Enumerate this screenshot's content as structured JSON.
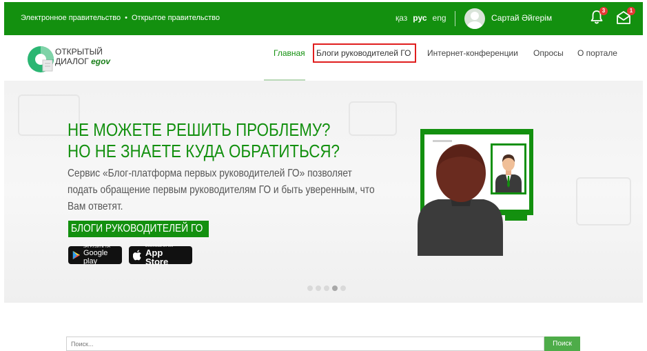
{
  "topbar": {
    "links": [
      "Электронное правительство",
      "Открытое правительство"
    ],
    "separator": "•",
    "languages": [
      {
        "code": "қаз",
        "active": false
      },
      {
        "code": "рус",
        "active": true
      },
      {
        "code": "eng",
        "active": false
      }
    ],
    "username": "Сартай Әйгерім",
    "notifications_count": "3",
    "messages_count": "1",
    "bg_color": "#13900f"
  },
  "header": {
    "logo_line1": "ОТКРЫТЫЙ",
    "logo_line2": "ДИАЛОГ",
    "logo_brand": "egov",
    "nav": {
      "main": "Главная",
      "blogs": "Блоги руководителей ГО",
      "conferences": "Интернет-конференции",
      "polls": "Опросы",
      "about": "О портале"
    }
  },
  "hero": {
    "headline1": "НЕ МОЖЕТЕ РЕШИТЬ ПРОБЛЕМУ?",
    "headline2": "НО НЕ ЗНАЕТЕ КУДА ОБРАТИТЬСЯ?",
    "description": "Сервис «Блог-платформа первых руководителей ГО» позволяет подать обращение первым руководителям ГО и быть уверенным, что Вам ответят.",
    "cta": "БЛОГИ РУКОВОДИТЕЛЕЙ ГО",
    "google_play_small": "ЗАГРУЗИТЕ НА",
    "google_play_big": "Google play",
    "app_store_small": "Download on the",
    "app_store_big": "App Store",
    "slides_total": 5,
    "slide_active": 4
  },
  "search": {
    "placeholder": "Поиск...",
    "button": "Поиск"
  }
}
